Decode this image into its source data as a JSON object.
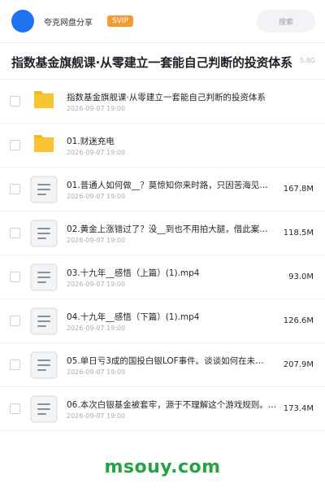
{
  "header": {
    "share_name": "夸克网盘分享",
    "badge": "SVIP",
    "search_label": "搜索"
  },
  "title": {
    "text": "指数基金旗舰课·从零建立一套能自己判断的投资体系",
    "size_fragment": "5.8G"
  },
  "files": [
    {
      "kind": "folder",
      "name": "指数基金旗舰课·从零建立一套能自己判断的投资体系",
      "date": "2026-09-07 19:00",
      "size": ""
    },
    {
      "kind": "folder",
      "name": "01.财迷充电",
      "date": "2026-09-07 19:00",
      "size": ""
    },
    {
      "kind": "file",
      "name": "01.普通人如何做__？莫惊知你来时路，只因苦海见…",
      "date": "2026-09-07 19:00",
      "size": "167.8M"
    },
    {
      "kind": "file",
      "name": "02.黄金上涨错过了？没__到也不用拍大腿，借此案…",
      "date": "2026-09-07 19:00",
      "size": "118.5M"
    },
    {
      "kind": "file",
      "name": "03.十九年__感悟（上篇）(1).mp4",
      "date": "2026-09-07 19:00",
      "size": "93.0M"
    },
    {
      "kind": "file",
      "name": "04.十九年__感悟（下篇）(1).mp4",
      "date": "2026-09-07 19:00",
      "size": "126.6M"
    },
    {
      "kind": "file",
      "name": "05.单日亏3成的国投白银LOF事件。谈谈如何在未…",
      "date": "2026-09-07 19:00",
      "size": "207.9M"
    },
    {
      "kind": "file",
      "name": "06.本次白银基金被套牢，源于不理解这个游戏规则。…",
      "date": "2026-09-07 19:00",
      "size": "173.4M"
    }
  ],
  "watermark": "msouy.com",
  "colors": {
    "avatar": "#1e73f3",
    "badge": "#f39c33",
    "folder": "#f7c534",
    "watermark": "#25a244"
  },
  "icons": {
    "folder": "folder-icon",
    "file": "document-icon"
  }
}
